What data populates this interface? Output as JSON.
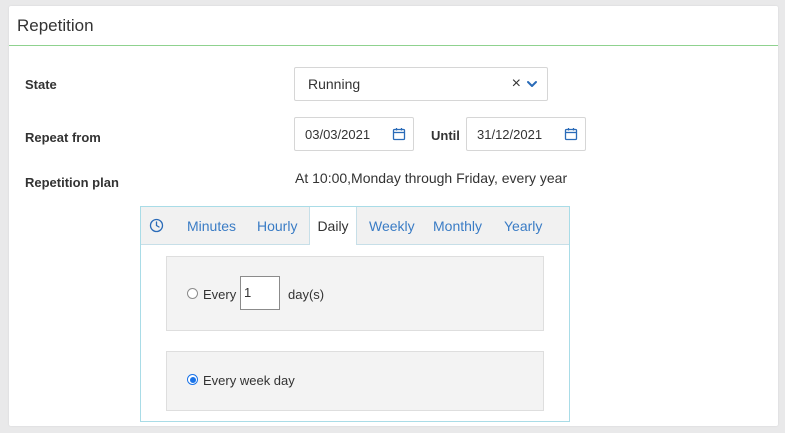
{
  "panel": {
    "title": "Repetition"
  },
  "state": {
    "label": "State",
    "value": "Running",
    "clear_icon": "×"
  },
  "repeat_from": {
    "label": "Repeat from",
    "from_date": "03/03/2021",
    "until_label": "Until",
    "until_date": "31/12/2021"
  },
  "plan": {
    "label": "Repetition plan",
    "summary": "At 10:00,Monday through Friday, every year"
  },
  "tabs": [
    {
      "label": "Minutes",
      "active": false
    },
    {
      "label": "Hourly",
      "active": false
    },
    {
      "label": "Daily",
      "active": true
    },
    {
      "label": "Weekly",
      "active": false
    },
    {
      "label": "Monthly",
      "active": false
    },
    {
      "label": "Yearly",
      "active": false
    }
  ],
  "daily": {
    "every_label": "Every",
    "every_value": "1",
    "unit": "day(s)",
    "every_checked": false,
    "weekday_label": "Every week day",
    "weekday_checked": true
  },
  "colors": {
    "accent": "#3a7cc5",
    "header_rule": "#8fd28f",
    "tab_border": "#a9dce7",
    "radio": "#1a73e8"
  },
  "icons": {
    "calendar": "calendar-icon",
    "clock": "clock-icon",
    "chevron": "chevron-down-icon",
    "clear": "clear-icon"
  }
}
